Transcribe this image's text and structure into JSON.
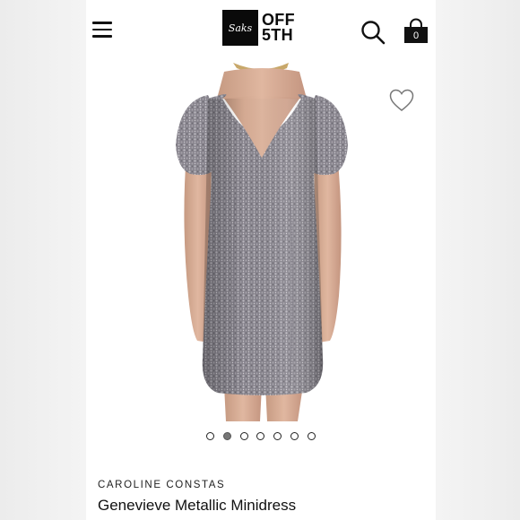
{
  "header": {
    "logo_mark": "Saks",
    "logo_line1": "OFF",
    "logo_line2": "5TH",
    "cart_count": "0",
    "icons": [
      "menu-icon",
      "search-icon",
      "shopping-bag-icon"
    ]
  },
  "gallery": {
    "image_count": 7,
    "active_index": 1,
    "wishlist_icon": "heart-outline-icon"
  },
  "product": {
    "brand": "CAROLINE CONSTAS",
    "name": "Genevieve Metallic Minidress"
  },
  "colors": {
    "logo_bg": "#0a0a0a",
    "dress": "#8a8790",
    "active_dot": "#777777"
  }
}
